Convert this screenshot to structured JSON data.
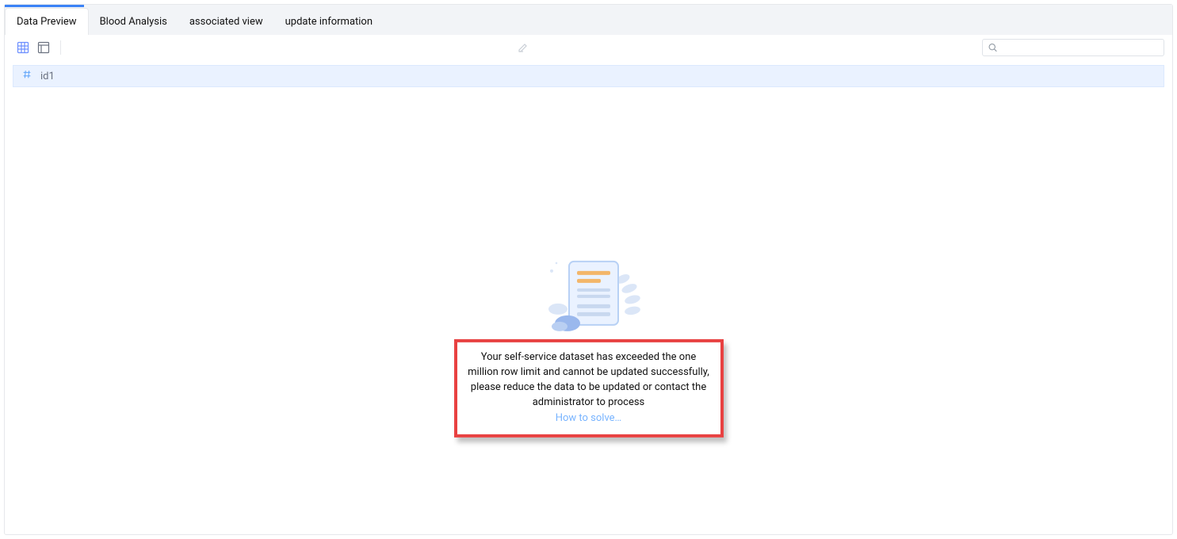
{
  "tabs": [
    {
      "label": "Data Preview",
      "active": true
    },
    {
      "label": "Blood Analysis",
      "active": false
    },
    {
      "label": "associated view",
      "active": false
    },
    {
      "label": "update information",
      "active": false
    }
  ],
  "toolbar": {
    "grid_icon_name": "grid-icon",
    "layout_icon_name": "layout-icon",
    "edit_icon_name": "edit-icon",
    "search_placeholder": ""
  },
  "column": {
    "type_icon_name": "hash-icon",
    "name": "id1"
  },
  "message": {
    "text": "Your self-service dataset has exceeded the one million row limit and cannot be updated successfully, please reduce the data to be updated or contact the administrator to process",
    "link_label": "How to solve…"
  },
  "colors": {
    "accent": "#3b82f6",
    "tabbar_bg": "#f2f4f7",
    "column_bg": "#eaf2ff",
    "highlight_border": "#e84141",
    "link": "#78b4ff"
  }
}
